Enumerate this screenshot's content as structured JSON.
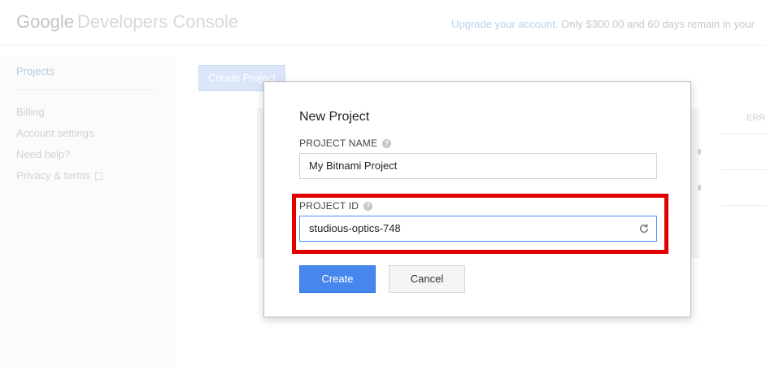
{
  "header": {
    "logo_google": "Google",
    "logo_product": "Developers Console",
    "upgrade_link": "Upgrade your account.",
    "trial_text": "Only $300.00 and 60 days remain in your"
  },
  "sidebar": {
    "items": [
      {
        "label": "Projects"
      },
      {
        "label": "Billing"
      },
      {
        "label": "Account settings"
      },
      {
        "label": "Need help?"
      },
      {
        "label": "Privacy & terms"
      }
    ]
  },
  "main": {
    "create_project_label": "Create Project",
    "table_column_partial": "ERR"
  },
  "dialog": {
    "title": "New Project",
    "project_name": {
      "label": "PROJECT NAME",
      "value": "My Bitnami Project"
    },
    "project_id": {
      "label": "PROJECT ID",
      "value": "studious-optics-748"
    },
    "help_glyph": "?",
    "create_label": "Create",
    "cancel_label": "Cancel"
  },
  "colors": {
    "primary_button": "#4787ed",
    "highlight_outline": "#e00000",
    "focus_border": "#4d90fe"
  },
  "icons": [
    "help-icon",
    "refresh-icon",
    "external-link-icon"
  ]
}
